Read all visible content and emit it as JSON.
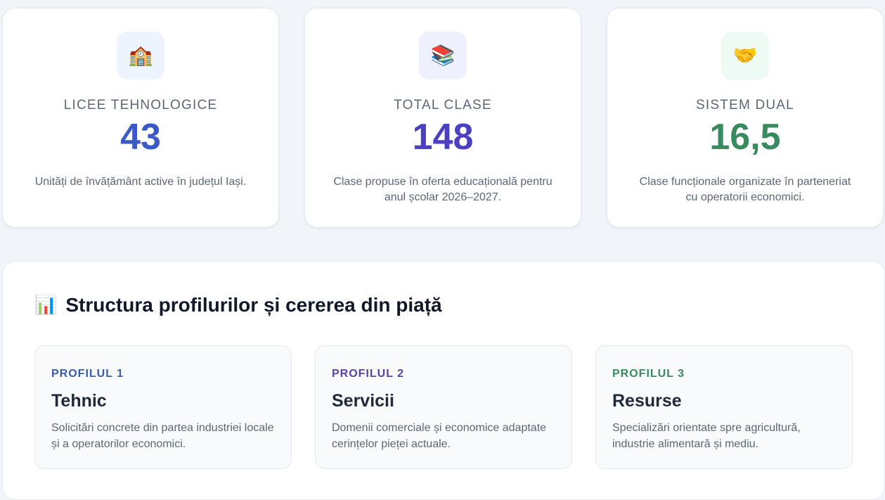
{
  "stats": [
    {
      "icon": "school-icon",
      "glyph": "🏫",
      "label": "LICEE TEHNOLOGICE",
      "value": "43",
      "description": "Unități de învățământ active în județul Iași.",
      "value_color": "#3a5bc7",
      "icon_bg": "#eef4fd"
    },
    {
      "icon": "books-icon",
      "glyph": "📚",
      "label": "TOTAL CLASE",
      "value": "148",
      "description": "Clase propuse în oferta educațională pentru anul școlar 2026–2027.",
      "value_color": "#4b3fc2",
      "icon_bg": "#eff0fd"
    },
    {
      "icon": "handshake-icon",
      "glyph": "🤝",
      "label": "SISTEM DUAL",
      "value": "16,5",
      "description": "Clase funcționale organizate în parteneriat cu operatorii economici.",
      "value_color": "#3a8a5f",
      "icon_bg": "#eefbf4"
    }
  ],
  "panel": {
    "icon": "bar-chart-icon",
    "glyph": "📊",
    "title": "Structura profilurilor și cererea din piață",
    "profiles": [
      {
        "tag": "PROFILUL 1",
        "name": "Tehnic",
        "description": "Solicitări concrete din partea industriei locale și a operatorilor economici.",
        "tag_color": "#3a5bb0"
      },
      {
        "tag": "PROFILUL 2",
        "name": "Servicii",
        "description": "Domenii comerciale și economice adaptate cerințelor pieței actuale.",
        "tag_color": "#5a42b0"
      },
      {
        "tag": "PROFILUL 3",
        "name": "Resurse",
        "description": "Specializări orientate spre agricultură, industrie alimentară și mediu.",
        "tag_color": "#3a8a5f"
      }
    ]
  }
}
